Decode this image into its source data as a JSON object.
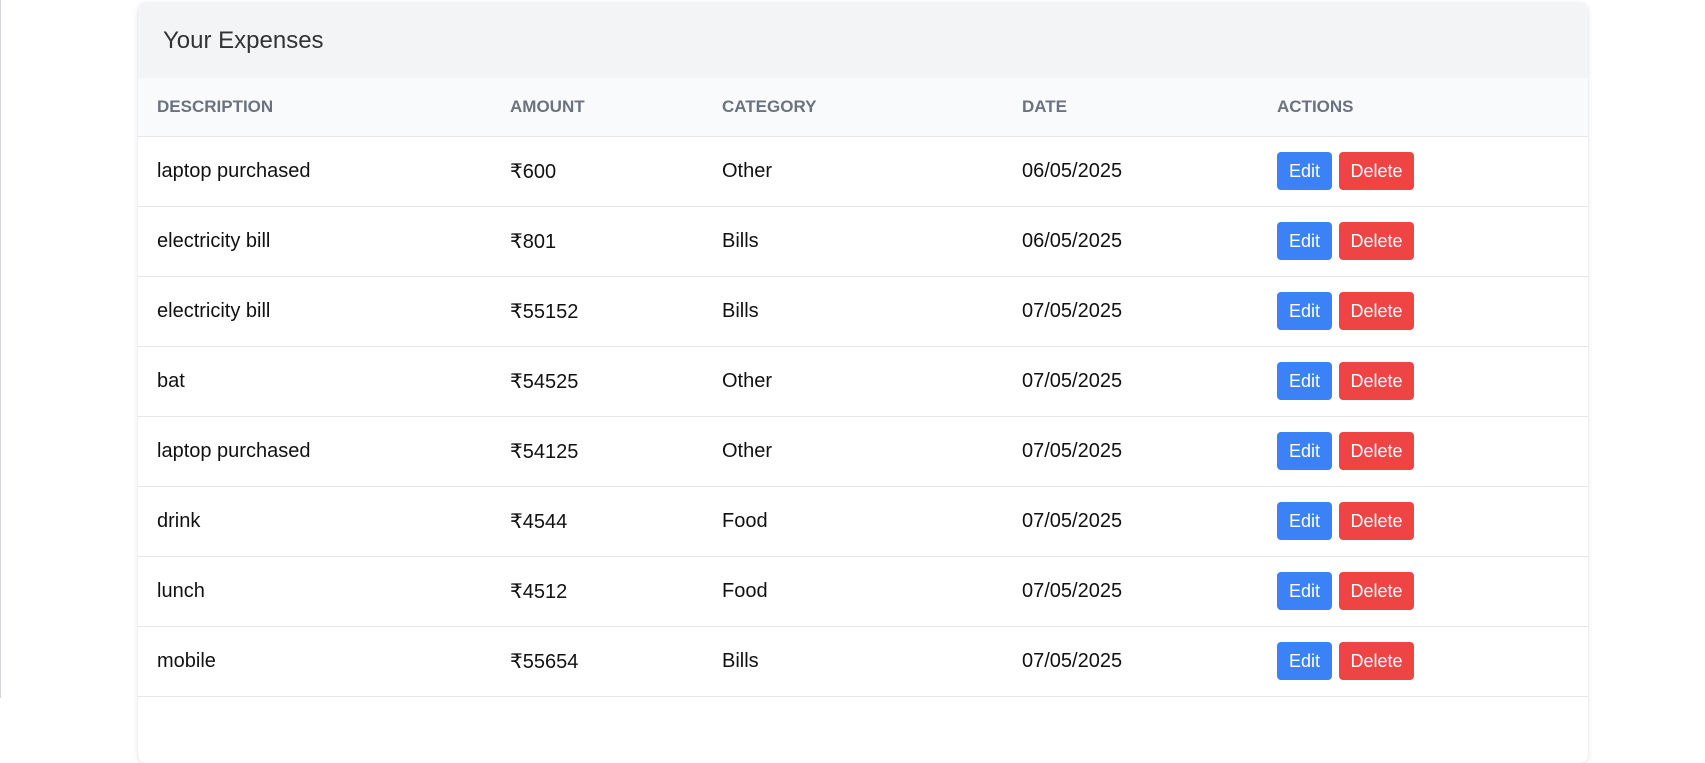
{
  "card": {
    "title": "Your Expenses"
  },
  "table": {
    "headers": {
      "description": "DESCRIPTION",
      "amount": "AMOUNT",
      "category": "CATEGORY",
      "date": "DATE",
      "actions": "ACTIONS"
    },
    "rows": [
      {
        "description": "laptop purchased",
        "amount": "₹600",
        "category": "Other",
        "date": "06/05/2025",
        "edit": "Edit",
        "delete": "Delete"
      },
      {
        "description": "electricity bill",
        "amount": "₹801",
        "category": "Bills",
        "date": "06/05/2025",
        "edit": "Edit",
        "delete": "Delete"
      },
      {
        "description": "electricity bill",
        "amount": "₹55152",
        "category": "Bills",
        "date": "07/05/2025",
        "edit": "Edit",
        "delete": "Delete"
      },
      {
        "description": "bat",
        "amount": "₹54525",
        "category": "Other",
        "date": "07/05/2025",
        "edit": "Edit",
        "delete": "Delete"
      },
      {
        "description": "laptop purchased",
        "amount": "₹54125",
        "category": "Other",
        "date": "07/05/2025",
        "edit": "Edit",
        "delete": "Delete"
      },
      {
        "description": "drink",
        "amount": "₹4544",
        "category": "Food",
        "date": "07/05/2025",
        "edit": "Edit",
        "delete": "Delete"
      },
      {
        "description": "lunch",
        "amount": "₹4512",
        "category": "Food",
        "date": "07/05/2025",
        "edit": "Edit",
        "delete": "Delete"
      },
      {
        "description": "mobile",
        "amount": "₹55654",
        "category": "Bills",
        "date": "07/05/2025",
        "edit": "Edit",
        "delete": "Delete"
      }
    ]
  },
  "colors": {
    "edit_button": "#3b82f6",
    "delete_button": "#ef4444",
    "header_bg": "#f3f4f6"
  }
}
